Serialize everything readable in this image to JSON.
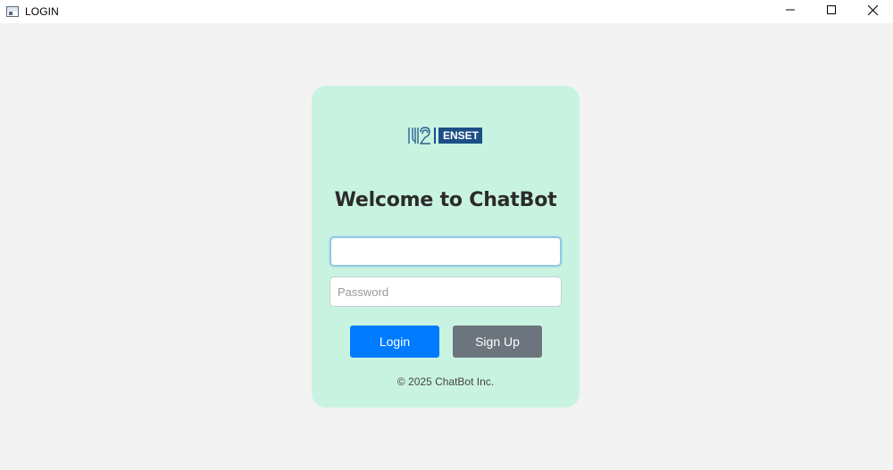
{
  "window": {
    "title": "LOGIN",
    "icon": "app-window-icon",
    "controls": [
      "minimize-icon",
      "maximize-icon",
      "close-icon"
    ]
  },
  "card": {
    "logo": {
      "text": "ENSET",
      "mark_text": "UH2",
      "color": "#1c4f86"
    },
    "heading": "Welcome to ChatBot",
    "username": {
      "value": "",
      "placeholder": ""
    },
    "password": {
      "value": "",
      "placeholder": "Password"
    },
    "login_label": "Login",
    "signup_label": "Sign Up",
    "footer": "© 2025 ChatBot Inc."
  },
  "colors": {
    "background": "#f3f3f3",
    "card": "#c9f3e1",
    "login_button": "#007bff",
    "signup_button": "#6c757d",
    "focus_border": "#8fc9dd"
  }
}
